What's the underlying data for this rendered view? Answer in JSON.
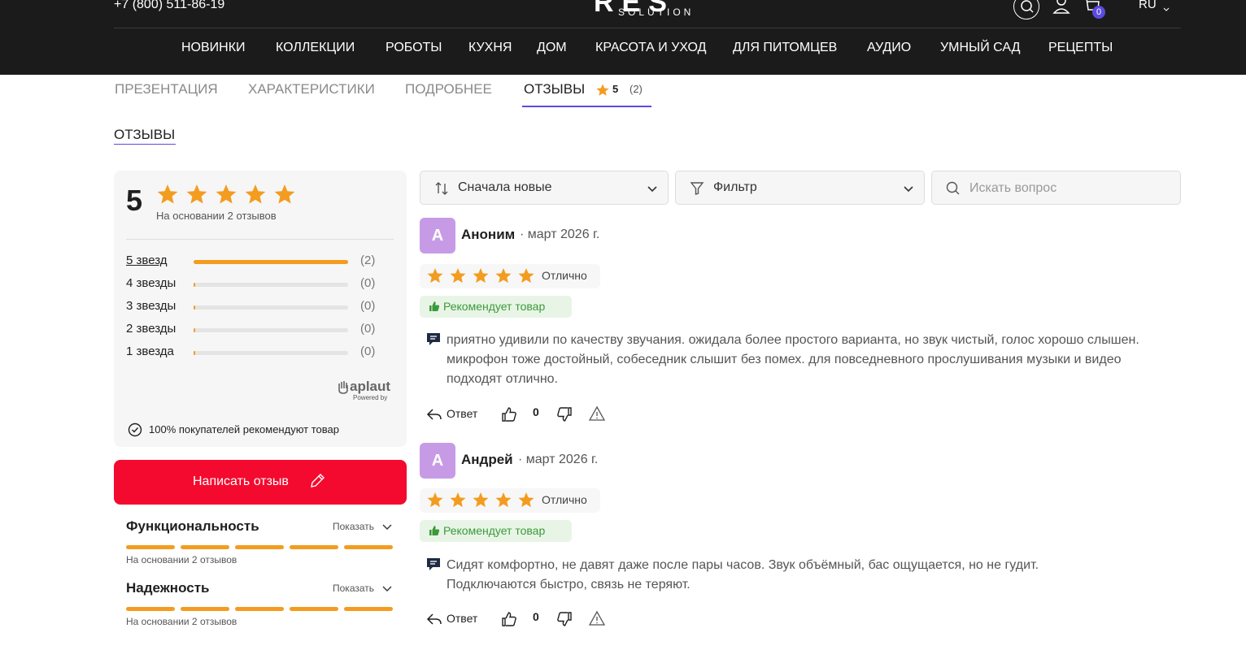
{
  "header": {
    "phone": "+7 (800) 511-86-19",
    "logo_main": "RES",
    "logo_sub": "SOLUTION",
    "cart_count": "0",
    "language": "RU"
  },
  "nav": {
    "items": [
      "НОВИНКИ",
      "КОЛЛЕКЦИИ",
      "РОБОТЫ",
      "КУХНЯ",
      "ДОМ",
      "КРАСОТА И УХОД",
      "ДЛЯ ПИТОМЦЕВ",
      "АУДИО",
      "УМНЫЙ САД",
      "РЕЦЕПТЫ"
    ]
  },
  "tabs": {
    "items": [
      "ПРЕЗЕНТАЦИЯ",
      "ХАРАКТЕРИСТИКИ",
      "ПОДРОБНЕЕ",
      "ОТЗЫВЫ"
    ],
    "rating": "5",
    "count": "(2)"
  },
  "section_title": "ОТЗЫВЫ",
  "summary": {
    "rating": "5",
    "stars": 5,
    "based_on": "На основании 2 отзывов",
    "distribution": [
      {
        "label": "5 звезд",
        "count": "(2)",
        "fraction": 1.0
      },
      {
        "label": "4 звезды",
        "count": "(0)",
        "fraction": 0.0
      },
      {
        "label": "3 звезды",
        "count": "(0)",
        "fraction": 0.0
      },
      {
        "label": "2 звезды",
        "count": "(0)",
        "fraction": 0.0
      },
      {
        "label": "1 звезда",
        "count": "(0)",
        "fraction": 0.0
      }
    ],
    "powered_brand": "aplaut",
    "powered_by": "Powered by",
    "recommend_text": "100% покупателей рекомендуют товар"
  },
  "write_review": "Написать отзыв",
  "attributes": [
    {
      "title": "Функциональность",
      "show": "Показать",
      "based_on": "На основании 2 отзывов",
      "score": 5
    },
    {
      "title": "Надежность",
      "show": "Показать",
      "based_on": "На основании 2 отзывов",
      "score": 5
    }
  ],
  "controls": {
    "sort": "Сначала новые",
    "filter": "Фильтр",
    "search_placeholder": "Искать вопрос"
  },
  "reviews": [
    {
      "initial": "А",
      "author": "Аноним",
      "date": "· март 2026 г.",
      "stars": 5,
      "rating_label": "Отлично",
      "recommend": "Рекомендует товар",
      "text": "приятно удивили по качеству звучания. ожидала более простого варианта, но звук чистый, голос хорошо слышен. микрофон тоже достойный, собеседник слышит без помех. для повседневного прослушивания музыки и видео подходят отлично.",
      "reply": "Ответ",
      "votes": "0"
    },
    {
      "initial": "А",
      "author": "Андрей",
      "date": "· март 2026 г.",
      "stars": 5,
      "rating_label": "Отлично",
      "recommend": "Рекомендует товар",
      "text": "Сидят комфортно, не давят даже после пары часов. Звук объёмный, бас ощущается, но не гудит. Подключаются быстро, связь не теряют.",
      "reply": "Ответ",
      "votes": "0"
    }
  ],
  "colors": {
    "accent": "#5b4bdf",
    "star": "#f39c1f",
    "cta": "#f40a2e",
    "avatar": "#c79ae6",
    "recommend": "#3a9a3a"
  }
}
